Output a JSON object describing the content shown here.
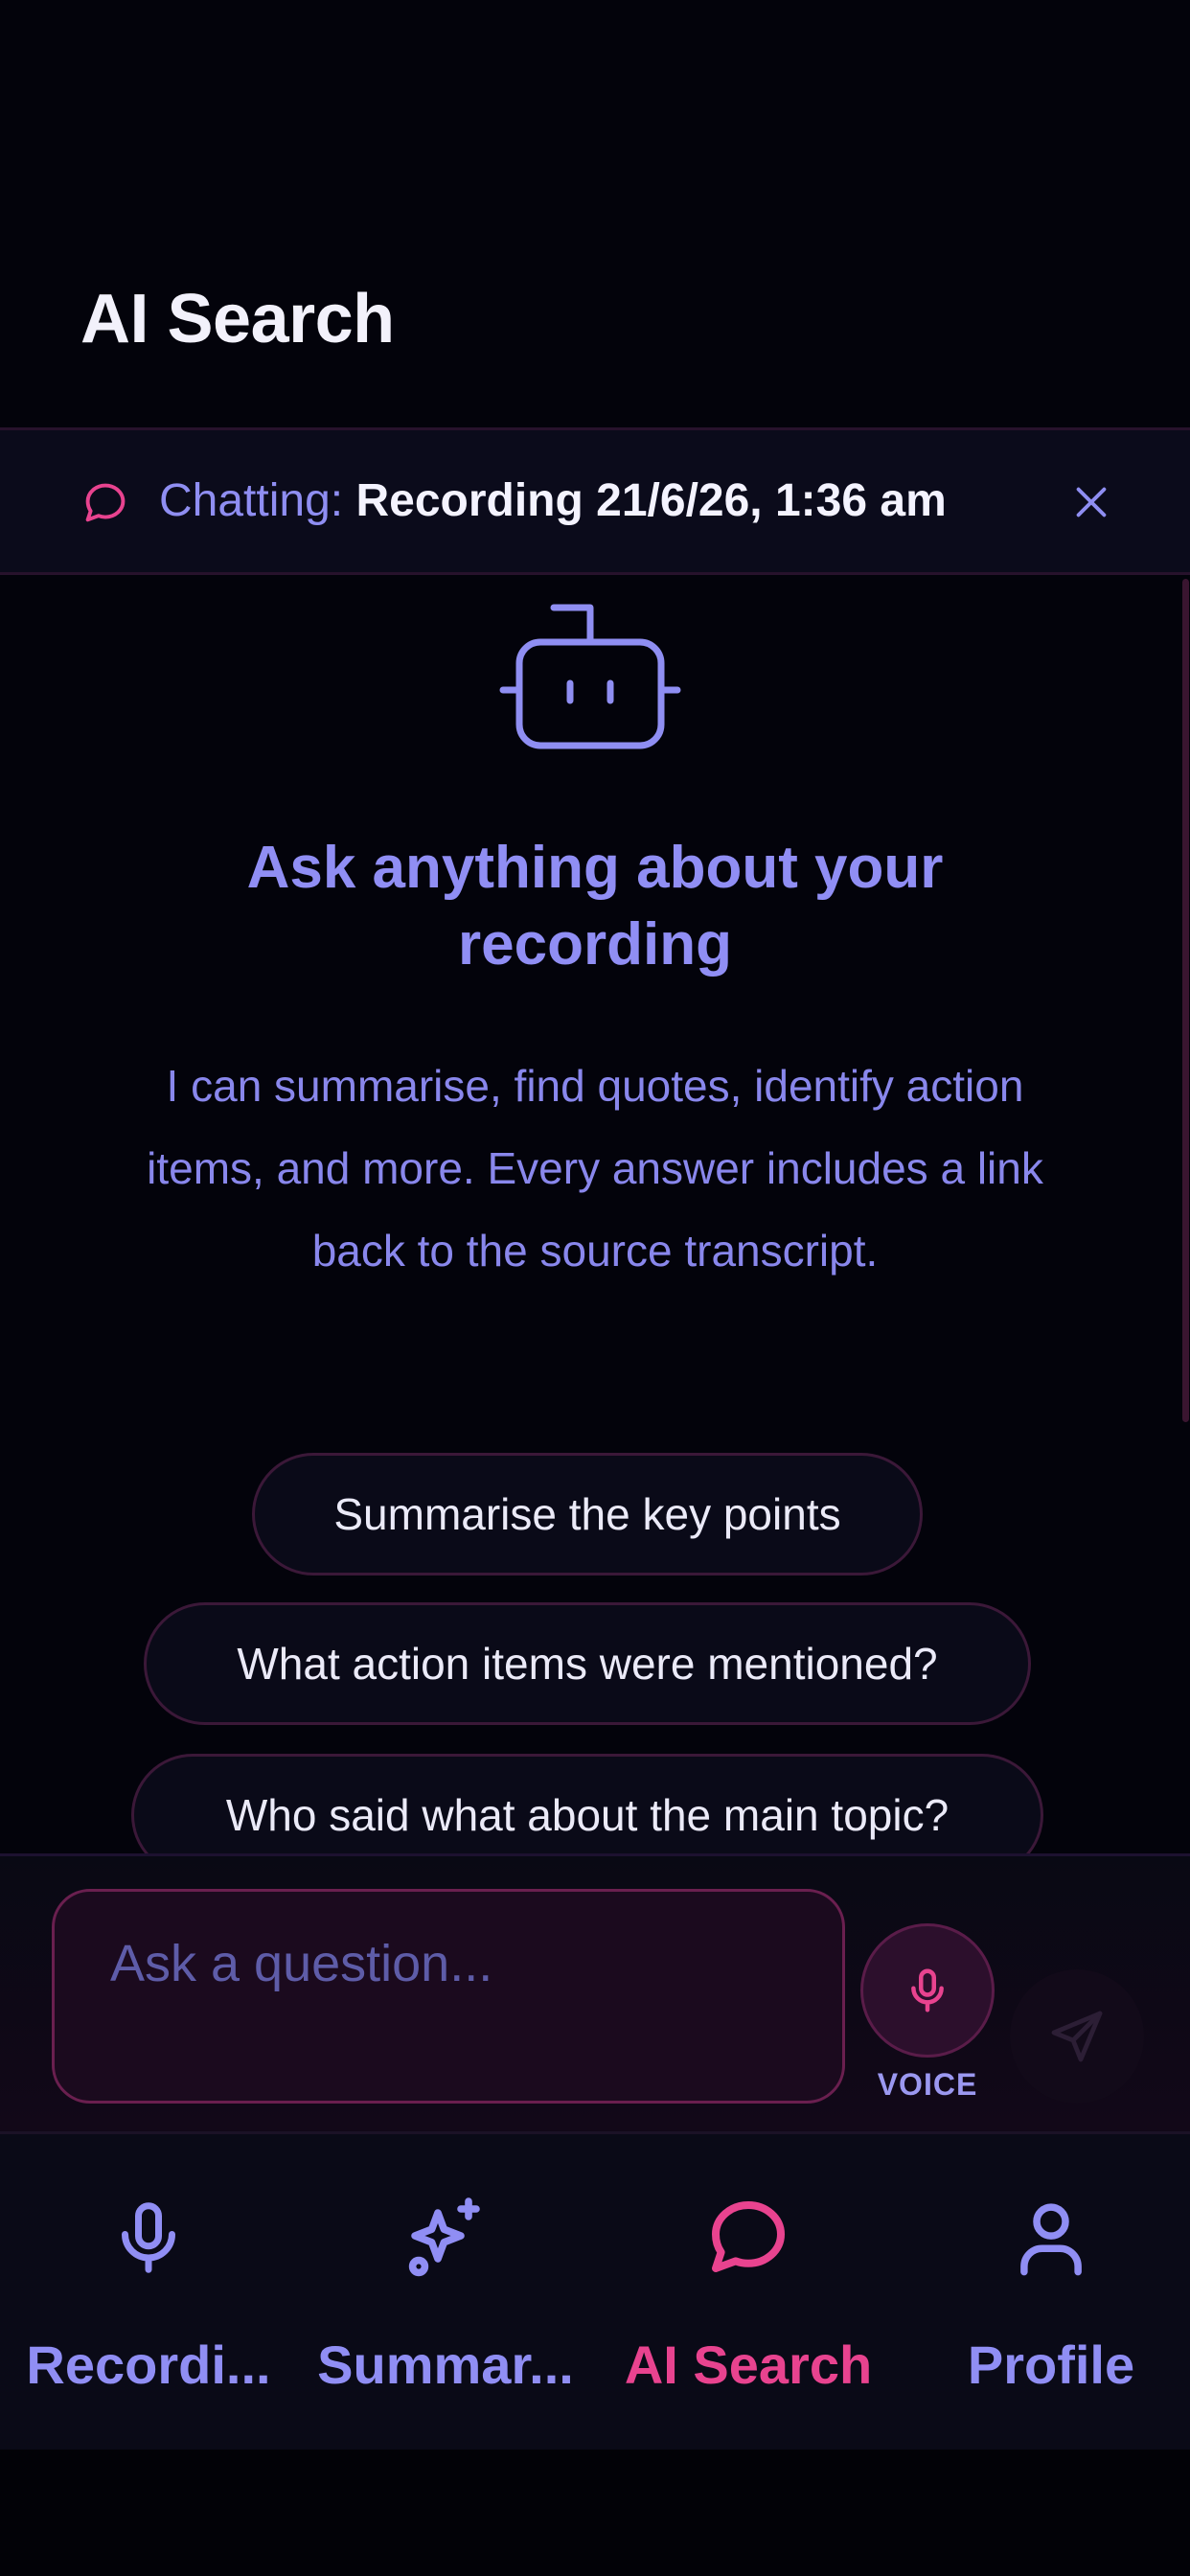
{
  "header": {
    "title": "AI Search"
  },
  "context_bar": {
    "prefix": "Chatting:",
    "recording_title": "Recording 21/6/26, 1:36 am",
    "icon": "chat-bubble-icon",
    "close_icon": "close-icon"
  },
  "empty_state": {
    "icon": "bot-icon",
    "heading": "Ask anything about your recording",
    "description": "I can summarise, find quotes, identify action items, and more. Every answer includes a link back to the source transcript."
  },
  "suggestions": [
    "Summarise the key points",
    "What action items were mentioned?",
    "Who said what about the main topic?"
  ],
  "composer": {
    "placeholder": "Ask a question...",
    "value": "",
    "voice_label": "VOICE",
    "voice_icon": "microphone-icon",
    "send_icon": "send-icon"
  },
  "bottom_nav": {
    "items": [
      {
        "label": "Recordi...",
        "icon": "microphone-icon",
        "active": false
      },
      {
        "label": "Summar...",
        "icon": "sparkles-icon",
        "active": false
      },
      {
        "label": "AI Search",
        "icon": "chat-bubble-icon",
        "active": true
      },
      {
        "label": "Profile",
        "icon": "user-icon",
        "active": false
      }
    ]
  },
  "colors": {
    "background": "#03030b",
    "accent_pink": "#e8438f",
    "accent_purple": "#908ef4",
    "text_primary": "#f2f1fb"
  }
}
